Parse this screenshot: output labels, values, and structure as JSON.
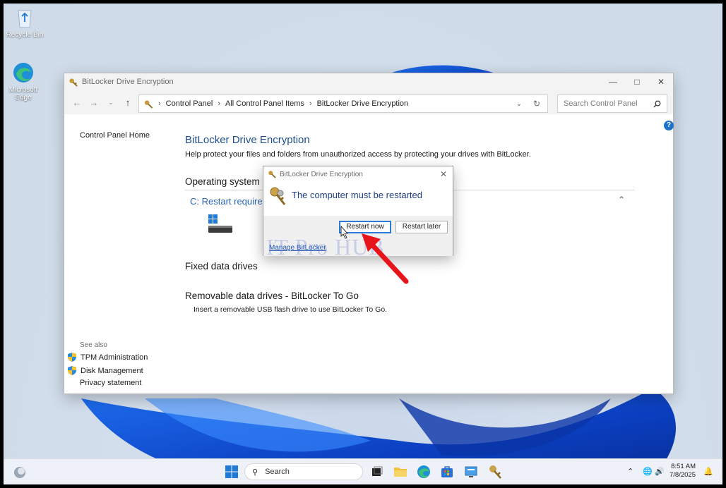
{
  "desktop": {
    "icons": [
      {
        "label": "Recycle Bin"
      },
      {
        "label": "Microsoft Edge"
      }
    ]
  },
  "window": {
    "title": "BitLocker Drive Encryption",
    "breadcrumb": [
      "Control Panel",
      "All Control Panel Items",
      "BitLocker Drive Encryption"
    ],
    "search_placeholder": "Search Control Panel",
    "left_nav": {
      "home": "Control Panel Home"
    },
    "see_also": {
      "heading": "See also",
      "items": [
        "TPM Administration",
        "Disk Management",
        "Privacy statement"
      ]
    },
    "content": {
      "heading": "BitLocker Drive Encryption",
      "description": "Help protect your files and folders from unauthorized access by protecting your drives with BitLocker.",
      "os_drive_heading": "Operating system drive",
      "os_drive": "C: Restart required",
      "fixed_heading": "Fixed data drives",
      "removable_heading": "Removable data drives - BitLocker To Go",
      "removable_desc": "Insert a removable USB flash drive to use BitLocker To Go."
    }
  },
  "dialog": {
    "title": "BitLocker Drive Encryption",
    "message": "The computer must be restarted",
    "restart_now": "Restart now",
    "restart_later": "Restart later",
    "manage_link": "Manage BitLocker"
  },
  "watermark": "IT Pro HUB",
  "taskbar": {
    "search_placeholder": "Search",
    "time": "8:51 AM",
    "date": "7/8/2025"
  },
  "colors": {
    "accent": "#2a7ad8",
    "heading_blue": "#1f4e8c",
    "link_blue": "#1a55b5",
    "annotation_red": "#e8141b"
  }
}
